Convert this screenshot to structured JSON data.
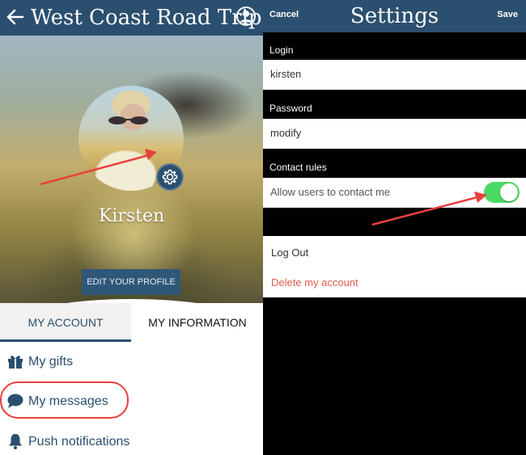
{
  "left": {
    "header": {
      "back_icon": "arrow-left-icon",
      "title": "West Coast Road Trip",
      "user_icon": "user-circle-icon"
    },
    "profile": {
      "name": "Kirsten",
      "edit_button": "EDIT YOUR PROFILE",
      "settings_icon": "gear-icon"
    },
    "tabs": [
      {
        "label": "MY ACCOUNT",
        "active": true
      },
      {
        "label": "MY INFORMATION",
        "active": false
      }
    ],
    "menu": [
      {
        "label": "My gifts",
        "icon": "gift-icon"
      },
      {
        "label": "My messages",
        "icon": "chat-bubble-icon",
        "highlighted": true
      },
      {
        "label": "Push notifications",
        "icon": "bell-icon"
      }
    ]
  },
  "right": {
    "header": {
      "cancel": "Cancel",
      "title": "Settings",
      "save": "Save"
    },
    "login": {
      "label": "Login",
      "value": "kirsten"
    },
    "password": {
      "label": "Password",
      "value": "modify"
    },
    "contact": {
      "label": "Contact rules",
      "toggle_label": "Allow users to contact me",
      "enabled": true
    },
    "actions": {
      "logout": "Log Out",
      "delete": "Delete my account"
    }
  },
  "colors": {
    "header": "#2b4f6f",
    "accent": "#2b4f6f",
    "toggle_on": "#4cd964",
    "danger": "#e25c50",
    "annotation": "#e8413f"
  }
}
